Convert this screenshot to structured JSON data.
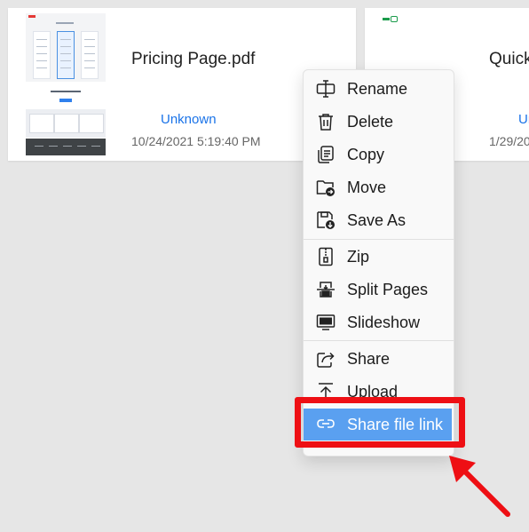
{
  "files": [
    {
      "name": "Pricing Page.pdf",
      "author": "Unknown",
      "date": "10/24/2021 5:19:40 PM"
    },
    {
      "name": "Quick",
      "author": "Un",
      "date": "1/29/20"
    }
  ],
  "context_menu": {
    "items": [
      {
        "label": "Rename",
        "icon": "rename-icon"
      },
      {
        "label": "Delete",
        "icon": "trash-icon"
      },
      {
        "label": "Copy",
        "icon": "copy-icon"
      },
      {
        "label": "Move",
        "icon": "move-folder-icon"
      },
      {
        "label": "Save As",
        "icon": "save-as-icon"
      },
      {
        "label": "Zip",
        "icon": "zip-icon"
      },
      {
        "label": "Split Pages",
        "icon": "split-pages-icon"
      },
      {
        "label": "Slideshow",
        "icon": "slideshow-icon"
      },
      {
        "label": "Share",
        "icon": "share-icon"
      },
      {
        "label": "Upload",
        "icon": "upload-icon"
      },
      {
        "label": "Share file link",
        "icon": "link-icon"
      }
    ],
    "highlighted_item": "Share file link"
  },
  "colors": {
    "highlight": "#5aa0f0",
    "annotation": "#ee0f14",
    "link_text": "#1a73e8"
  }
}
